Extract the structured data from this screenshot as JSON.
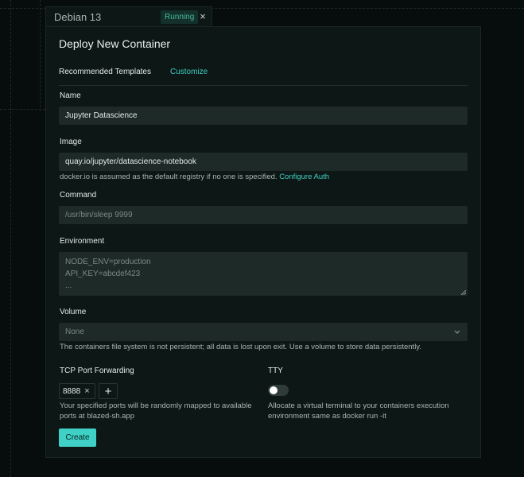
{
  "window_tab": {
    "title": "Debian 13",
    "status": "Running",
    "close_glyph": "×"
  },
  "modal": {
    "title": "Deploy New Container",
    "tabs": [
      {
        "label": "Recommended Templates",
        "active": false
      },
      {
        "label": "Customize",
        "active": true
      }
    ]
  },
  "form": {
    "name": {
      "label": "Name",
      "value": "Jupyter Datascience"
    },
    "image": {
      "label": "Image",
      "value": "quay.io/jupyter/datascience-notebook",
      "help": "docker.io is assumed as the default registry if no one is specified.",
      "help_link": "Configure Auth"
    },
    "command": {
      "label": "Command",
      "placeholder": "/usr/bin/sleep 9999"
    },
    "environment": {
      "label": "Environment",
      "placeholder": "NODE_ENV=production\nAPI_KEY=abcdef423\n..."
    },
    "volume": {
      "label": "Volume",
      "selected": "None",
      "help": "The containers file system is not persistent; all data is lost upon exit. Use a volume to store data persistently."
    },
    "ports": {
      "label": "TCP Port Forwarding",
      "entries": [
        "8888"
      ],
      "add_glyph": "+",
      "remove_glyph": "×",
      "help_line1": "Your specified ports will be randomly mapped to available",
      "help_line2": "ports at blazed-sh.app"
    },
    "tty": {
      "label": "TTY",
      "enabled": false,
      "help_line1": "Allocate a virtual terminal to your containers execution",
      "help_line2": "environment same as docker run -it"
    },
    "submit_label": "Create"
  },
  "colors": {
    "accent": "#3fd1c5",
    "background": "#060d0c",
    "panel": "#0d1715",
    "field": "#1e2a28",
    "status_bg": "#13302a",
    "status_fg": "#47b99c"
  },
  "icons": {
    "close": "close-icon",
    "chevron": "chevron-down-icon",
    "add": "plus-icon",
    "resize": "resize-grip-icon"
  }
}
